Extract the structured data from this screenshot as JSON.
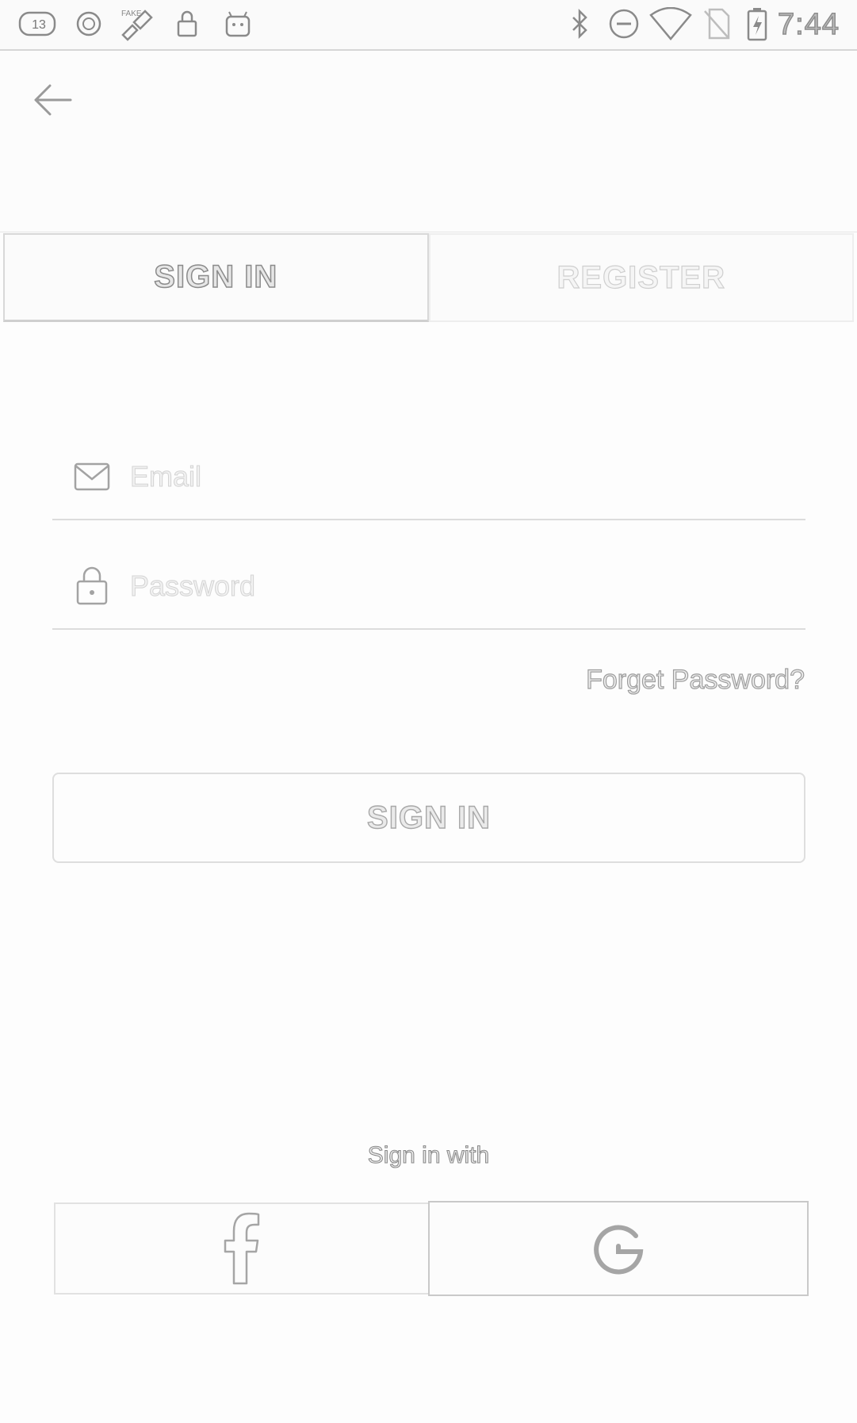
{
  "status_bar": {
    "time": "7:44",
    "notification_badge": "13",
    "icons": [
      "notification-icon",
      "alarm-icon",
      "fake-gps-icon",
      "lock-icon",
      "android-icon",
      "bluetooth-icon",
      "do-not-disturb-icon",
      "wifi-icon",
      "no-sim-icon",
      "battery-charging-icon"
    ]
  },
  "header": {
    "back_icon": "back-arrow-icon"
  },
  "tabs": [
    {
      "label": "SIGN IN",
      "active": true
    },
    {
      "label": "REGISTER",
      "active": false
    }
  ],
  "form": {
    "email": {
      "placeholder": "Email",
      "value": "",
      "icon": "mail-icon"
    },
    "password": {
      "placeholder": "Password",
      "value": "",
      "icon": "lock-icon"
    },
    "forgot_label": "Forget Password?",
    "submit_label": "SIGN IN"
  },
  "social": {
    "caption": "Sign in with",
    "providers": [
      {
        "name": "facebook",
        "icon": "facebook-icon"
      },
      {
        "name": "google",
        "icon": "google-icon"
      }
    ]
  }
}
